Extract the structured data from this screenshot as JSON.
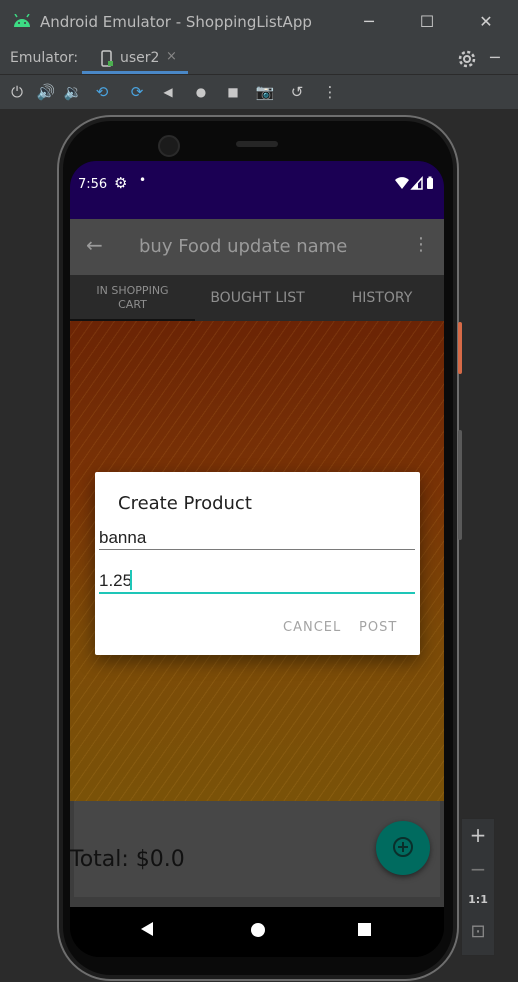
{
  "window": {
    "title": "Android Emulator - ShoppingListApp",
    "controls": {
      "minimize": "─",
      "maximize": "☐",
      "close": "✕"
    }
  },
  "emulator_bar": {
    "label": "Emulator:",
    "tab_label": "user2",
    "tab_close": "×",
    "settings_icon": "gear-icon",
    "minimize_icon": "─"
  },
  "toolbar": {
    "icons": [
      "power-icon",
      "volume-up-icon",
      "volume-down-icon",
      "rotate-left-icon",
      "rotate-right-icon",
      "back-icon",
      "home-icon",
      "overview-icon",
      "camera-icon",
      "snapshot-icon",
      "more-icon"
    ],
    "glyphs": [
      "⏻",
      "🔊",
      "🔉",
      "⟲",
      "⟳",
      "◀",
      "●",
      "■",
      "📷",
      "↺",
      "⋮"
    ]
  },
  "statusbar": {
    "time": "7:56",
    "gear": "⚙",
    "dot": "•",
    "icons": [
      "wifi-icon",
      "signal-icon",
      "battery-icon"
    ]
  },
  "appbar": {
    "back": "←",
    "title": "buy Food update name",
    "menu": "⋮"
  },
  "tabs": [
    {
      "label": "IN SHOPPING\nCART",
      "selected": true
    },
    {
      "label": "BOUGHT LIST",
      "selected": false
    },
    {
      "label": "HISTORY",
      "selected": false
    }
  ],
  "footer": {
    "total": "Total: $0.0"
  },
  "dialog": {
    "title": "Create Product",
    "name_value": "banna",
    "price_value": "1.25",
    "cancel_label": "CANCEL",
    "post_label": "POST"
  },
  "side_controls": {
    "zoom_in": "+",
    "zoom_out": "−",
    "one_to_one": "1:1",
    "fit": "⊡"
  },
  "colors": {
    "status_bar": "#1b0054",
    "accent_teal": "#1ec6b8",
    "fab": "#006b5f",
    "tab_underline": "#4a88c7"
  }
}
